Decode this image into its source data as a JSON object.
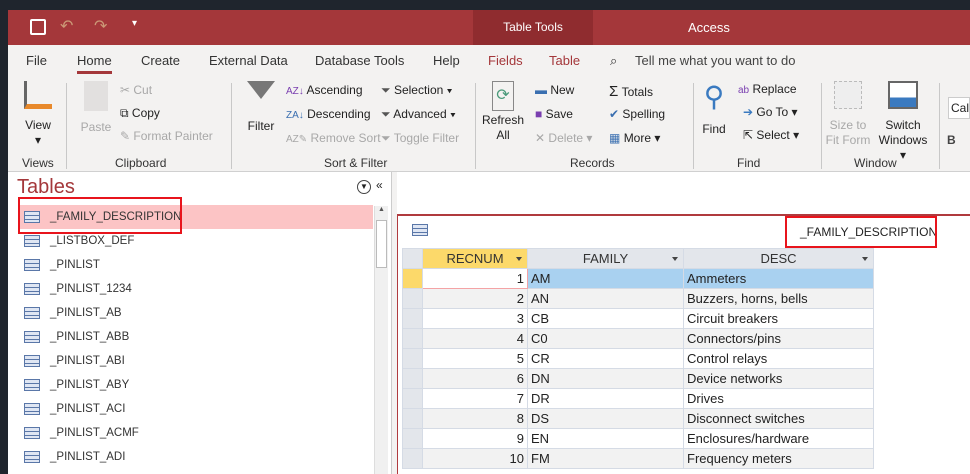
{
  "title_bar": {
    "context_tab": "Table Tools",
    "app": "Access"
  },
  "tabs": [
    "File",
    "Home",
    "Create",
    "External Data",
    "Database Tools",
    "Help",
    "Fields",
    "Table"
  ],
  "tell_me": "Tell me what you want to do",
  "ribbon": {
    "views": {
      "view": "View",
      "group": "Views"
    },
    "clipboard": {
      "paste": "Paste",
      "cut": "Cut",
      "copy": "Copy",
      "format_painter": "Format Painter",
      "group": "Clipboard"
    },
    "sort_filter": {
      "filter": "Filter",
      "ascending": "Ascending",
      "descending": "Descending",
      "remove_sort": "Remove Sort",
      "selection": "Selection",
      "advanced": "Advanced",
      "toggle_filter": "Toggle Filter",
      "group": "Sort & Filter"
    },
    "records": {
      "refresh": "Refresh",
      "refresh2": "All",
      "new": "New",
      "save": "Save",
      "delete": "Delete",
      "totals": "Totals",
      "spelling": "Spelling",
      "more": "More",
      "group": "Records"
    },
    "find": {
      "find": "Find",
      "replace": "Replace",
      "goto": "Go To",
      "select": "Select",
      "group": "Find"
    },
    "window": {
      "size1": "Size to",
      "size2": "Fit Form",
      "switch1": "Switch",
      "switch2": "Windows",
      "group": "Window"
    },
    "font": {
      "font_name": "Cal",
      "bold": "B"
    }
  },
  "nav": {
    "title": "Tables",
    "items": [
      "_FAMILY_DESCRIPTION",
      "_LISTBOX_DEF",
      "_PINLIST",
      "_PINLIST_1234",
      "_PINLIST_AB",
      "_PINLIST_ABB",
      "_PINLIST_ABI",
      "_PINLIST_ABY",
      "_PINLIST_ACI",
      "_PINLIST_ACMF",
      "_PINLIST_ADI"
    ]
  },
  "document": {
    "tab_title": "_FAMILY_DESCRIPTION",
    "columns": [
      "RECNUM",
      "FAMILY",
      "DESC"
    ],
    "rows": [
      [
        "1",
        "AM",
        "Ammeters"
      ],
      [
        "2",
        "AN",
        "Buzzers, horns, bells"
      ],
      [
        "3",
        "CB",
        "Circuit breakers"
      ],
      [
        "4",
        "C0",
        "Connectors/pins"
      ],
      [
        "5",
        "CR",
        "Control relays"
      ],
      [
        "6",
        "DN",
        "Device networks"
      ],
      [
        "7",
        "DR",
        "Drives"
      ],
      [
        "8",
        "DS",
        "Disconnect switches"
      ],
      [
        "9",
        "EN",
        "Enclosures/hardware"
      ],
      [
        "10",
        "FM",
        "Frequency meters"
      ]
    ]
  }
}
